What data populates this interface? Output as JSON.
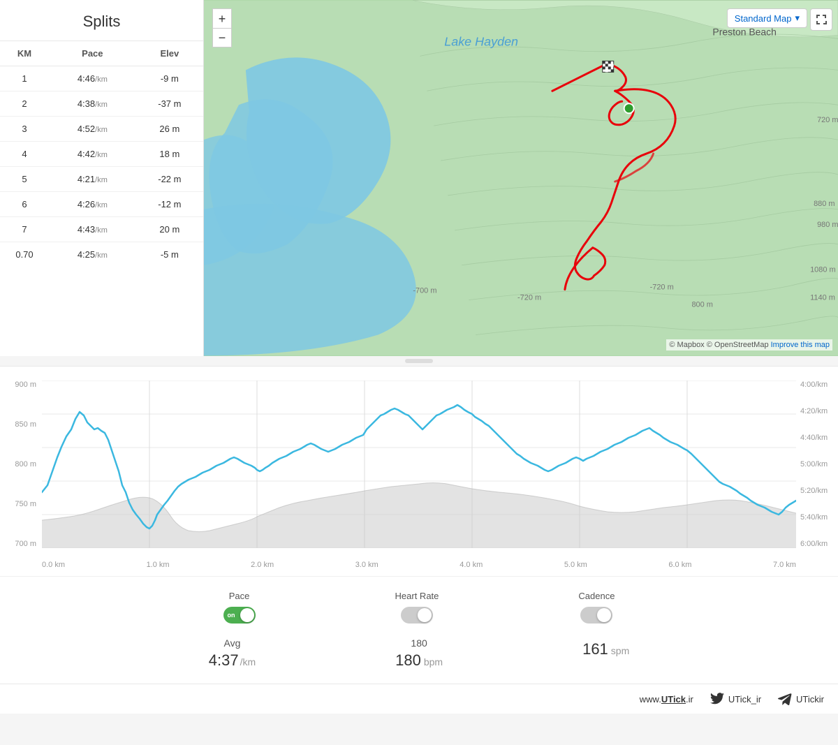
{
  "splits": {
    "title": "Splits",
    "columns": [
      "KM",
      "Pace",
      "Elev"
    ],
    "rows": [
      {
        "km": "1",
        "pace": "4:46",
        "pace_unit": "/km",
        "elev": "-9 m"
      },
      {
        "km": "2",
        "pace": "4:38",
        "pace_unit": "/km",
        "elev": "-37 m"
      },
      {
        "km": "3",
        "pace": "4:52",
        "pace_unit": "/km",
        "elev": "26 m"
      },
      {
        "km": "4",
        "pace": "4:42",
        "pace_unit": "/km",
        "elev": "18 m"
      },
      {
        "km": "5",
        "pace": "4:21",
        "pace_unit": "/km",
        "elev": "-22 m"
      },
      {
        "km": "6",
        "pace": "4:26",
        "pace_unit": "/km",
        "elev": "-12 m"
      },
      {
        "km": "7",
        "pace": "4:43",
        "pace_unit": "/km",
        "elev": "20 m"
      },
      {
        "km": "0.70",
        "pace": "4:25",
        "pace_unit": "/km",
        "elev": "-5 m"
      }
    ]
  },
  "map": {
    "type_button": "Standard Map",
    "place_label": "Lake Hayden",
    "place_label2": "Preston Beach",
    "attribution": "© Mapbox © OpenStreetMap",
    "improve_link": "Improve this map",
    "zoom_in": "+",
    "zoom_out": "−"
  },
  "chart": {
    "y_left_labels": [
      "900 m",
      "850 m",
      "800 m",
      "750 m",
      "700 m"
    ],
    "y_right_labels": [
      "4:00/km",
      "4:20/km",
      "4:40/km",
      "5:00/km",
      "5:20/km",
      "5:40/km",
      "6:00/km"
    ],
    "x_labels": [
      "0.0 km",
      "1.0 km",
      "2.0 km",
      "3.0 km",
      "4.0 km",
      "5.0 km",
      "6.0 km",
      "7.0 km"
    ]
  },
  "toggles": {
    "pace": {
      "label": "Pace",
      "state": "on"
    },
    "heart_rate": {
      "label": "Heart Rate",
      "state": "off"
    },
    "cadence": {
      "label": "Cadence",
      "state": "off"
    }
  },
  "stats": {
    "avg_label": "Avg",
    "pace_value": "4:37",
    "pace_unit": "/km",
    "heart_rate_value": "180",
    "heart_rate_unit": "bpm",
    "cadence_value": "161",
    "cadence_unit": "spm"
  },
  "footer": {
    "website": "www.UTick.ir",
    "twitter": "UTick_ir",
    "telegram": "UTickir"
  }
}
